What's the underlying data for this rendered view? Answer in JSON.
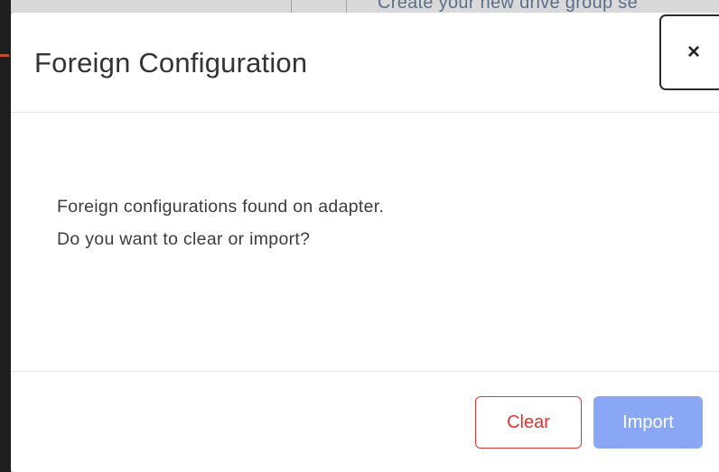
{
  "background": {
    "partial_text": "Create your new drive group se"
  },
  "dialog": {
    "title": "Foreign Configuration",
    "close_label": "×",
    "message_line1": "Foreign configurations found on adapter.",
    "message_line2": "Do you want to clear or import?",
    "buttons": {
      "clear_label": "Clear",
      "import_label": "Import"
    }
  },
  "colors": {
    "clear_accent": "#e3342f",
    "import_bg": "#8aa7f5",
    "title_text": "#333333"
  },
  "icons": {
    "close": "close-icon"
  }
}
